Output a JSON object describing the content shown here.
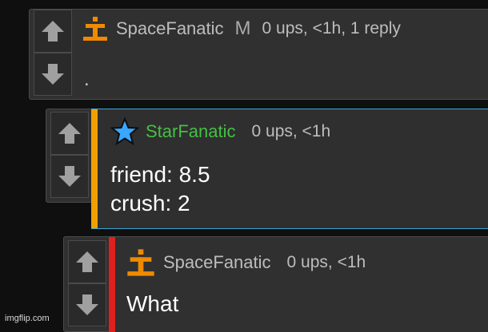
{
  "comments": [
    {
      "username": "SpaceFanatic",
      "username_color": "#bdbdbd",
      "badge": "M",
      "meta": "0 ups, <1h, 1 reply",
      "body": ".",
      "rank_icon": "orange-t-rank-icon",
      "rank_color": "#f08a00"
    },
    {
      "username": "StarFanatic",
      "username_color": "#3fbf3f",
      "meta": "0 ups, <1h",
      "body": "friend: 8.5\ncrush: 2",
      "rank_icon": "blue-star-icon",
      "rank_color": "#3aa7ff",
      "accent_color": "#f0a000",
      "highlight_border_color": "#3aa7d6"
    },
    {
      "username": "SpaceFanatic",
      "username_color": "#bdbdbd",
      "meta": "0 ups, <1h",
      "body": "What",
      "rank_icon": "orange-t-rank-icon",
      "rank_color": "#f08a00",
      "accent_color": "#e02020"
    }
  ],
  "vote": {
    "up_icon": "up-arrow-icon",
    "down_icon": "down-arrow-icon"
  },
  "watermark": "imgflip.com"
}
